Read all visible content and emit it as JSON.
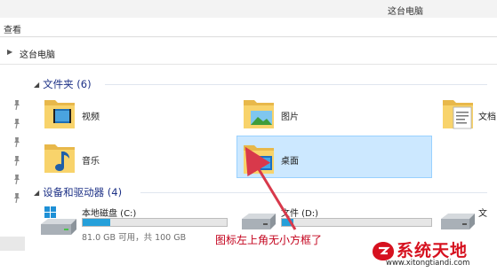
{
  "window": {
    "title": "这台电脑"
  },
  "ribbon": {
    "tab_view": "查看"
  },
  "address": {
    "breadcrumb": "这台电脑"
  },
  "folders_group": {
    "header": "文件夹 (6)",
    "items": [
      {
        "label": "视频",
        "icon": "video-folder-icon"
      },
      {
        "label": "图片",
        "icon": "pictures-folder-icon"
      },
      {
        "label": "文档",
        "icon": "documents-folder-icon"
      },
      {
        "label": "音乐",
        "icon": "music-folder-icon"
      },
      {
        "label": "桌面",
        "icon": "desktop-folder-icon",
        "selected": true
      }
    ]
  },
  "drives_group": {
    "header": "设备和驱动器 (4)",
    "items": [
      {
        "label": "本地磁盘 (C:)",
        "free_text": "81.0 GB 可用，共 100 GB",
        "used_fraction": 0.19
      },
      {
        "label": "文件 (D:)",
        "used_fraction": 0.08
      },
      {
        "label": "文"
      }
    ]
  },
  "annotation": {
    "text": "图标左上角无小方框了"
  },
  "watermark": {
    "brand": "系统天地",
    "url": "www.xitongtiandi.com"
  },
  "colors": {
    "accent": "#26a0da",
    "selection": "#cce8ff",
    "annotation": "#c3001b",
    "folder_yellow": "#f8d36b"
  }
}
